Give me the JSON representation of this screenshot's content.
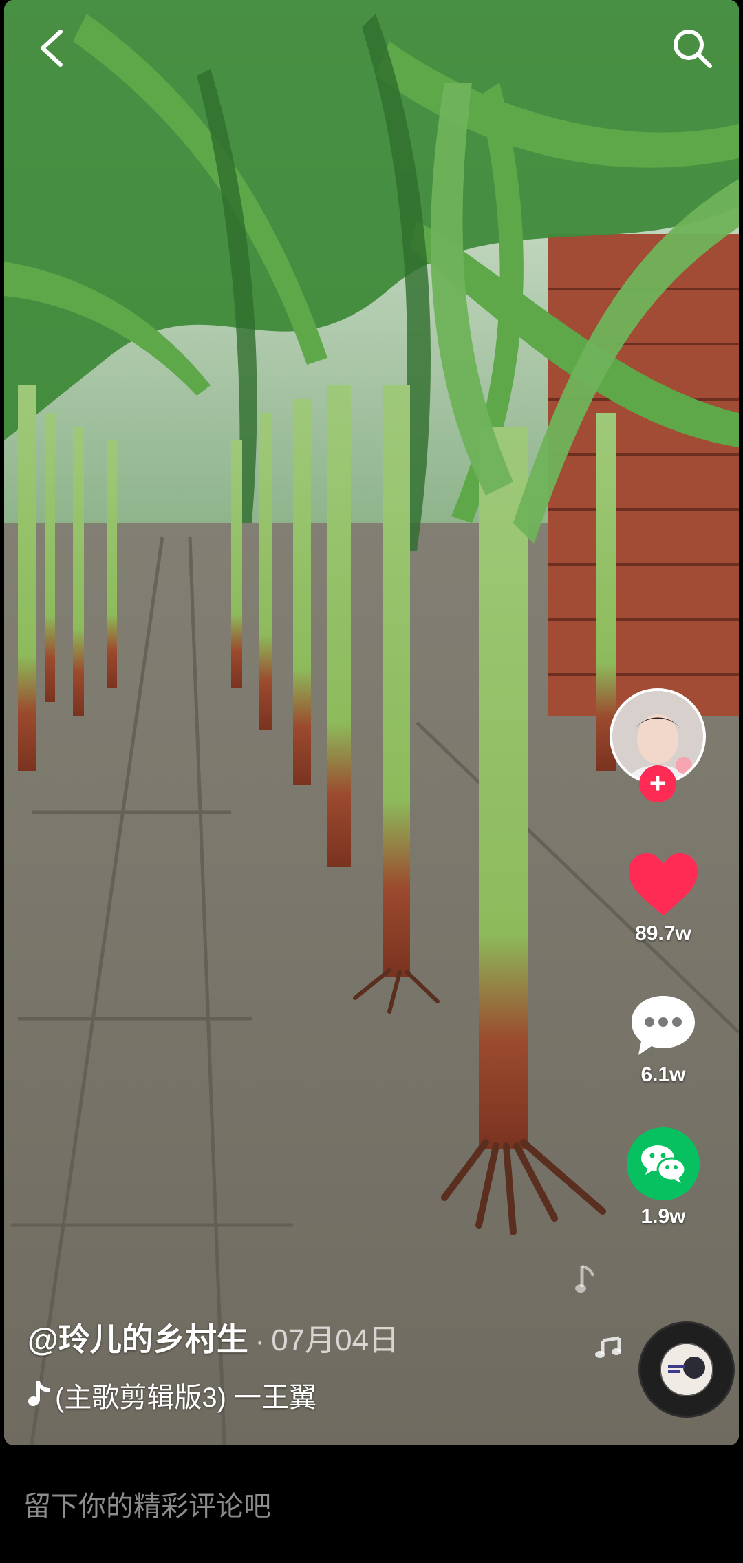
{
  "top_bar": {
    "back_icon": "chevron-left-icon",
    "search_icon": "search-icon"
  },
  "creator": {
    "handle": "@玲儿的乡村生",
    "date": "07月04日",
    "separator": "·"
  },
  "music": {
    "title": "(主歌剪辑版3) 一王翼"
  },
  "actions": {
    "likes": "89.7w",
    "comments": "6.1w",
    "shares": "1.9w",
    "like_color": "#fe2c55",
    "share_color": "#07c160",
    "follow_label": "+"
  },
  "comment_bar": {
    "placeholder": "留下你的精彩评论吧"
  }
}
